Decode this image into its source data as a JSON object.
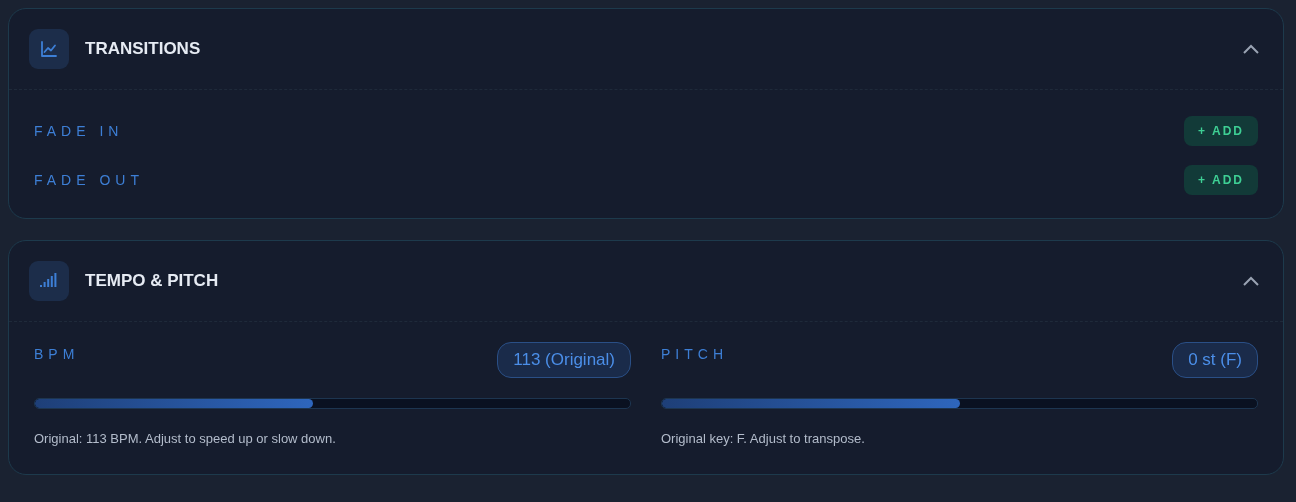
{
  "panels": [
    {
      "kind": "transitions",
      "title": "TRANSITIONS",
      "expanded": true,
      "rows": [
        {
          "label": "FADE IN",
          "button": "+ ADD"
        },
        {
          "label": "FADE OUT",
          "button": "+ ADD"
        }
      ]
    },
    {
      "kind": "sliders",
      "title": "TEMPO & PITCH",
      "expanded": true,
      "sliders": [
        {
          "label": "BPM",
          "value": "113 (Original)",
          "level": 0.467,
          "hint": "Original: 113 BPM. Adjust to speed up or slow down."
        },
        {
          "label": "PITCH",
          "value": "0 st (F)",
          "level": 0.5,
          "hint": "Original key: F. Adjust to transpose."
        }
      ]
    }
  ]
}
